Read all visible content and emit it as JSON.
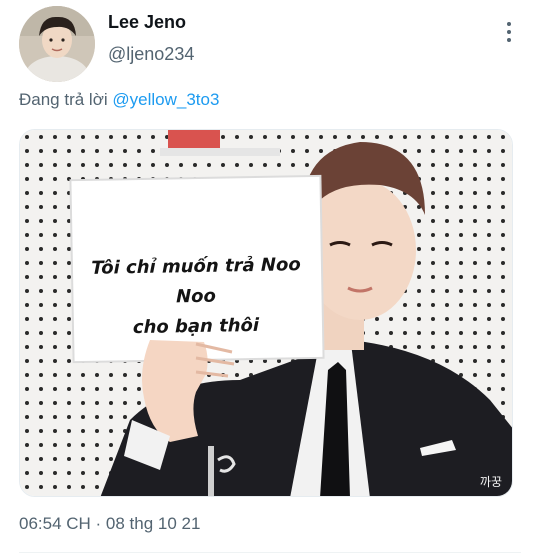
{
  "tweet": {
    "author": {
      "display_name": "Lee Jeno",
      "handle": "@ljeno234",
      "avatar_icon": "profile-photo"
    },
    "reply": {
      "prefix": "Đang trả lời",
      "mention": "@yellow_3to3"
    },
    "media": {
      "sign_line_1": "Tôi chỉ muốn trả Noo Noo",
      "sign_line_2": "cho bạn thôi",
      "watermark": "까꿍"
    },
    "timestamp": "06:54 CH · 08 thg 10 21"
  },
  "colors": {
    "link": "#1d9bf0",
    "secondary_text": "#536471",
    "primary_text": "#0f1419"
  }
}
